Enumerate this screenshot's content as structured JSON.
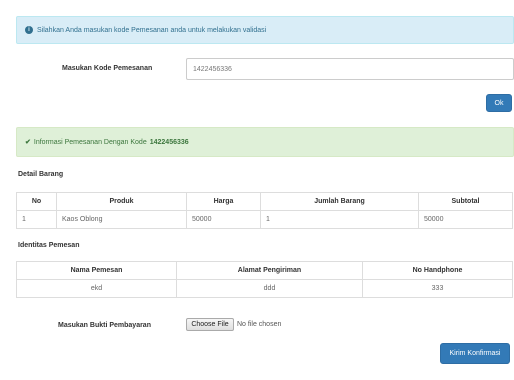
{
  "info_alert": {
    "text": "Silahkan Anda masukan kode Pemesanan anda untuk melakukan validasi"
  },
  "kode_form": {
    "label": "Masukan Kode Pemesanan",
    "value": "1422456336",
    "button": "Ok"
  },
  "success_alert": {
    "text": "Informasi Pemesanan Dengan Kode",
    "code": "1422456336"
  },
  "detail_barang": {
    "title": "Detail Barang",
    "headers": [
      "No",
      "Produk",
      "Harga",
      "Jumlah Barang",
      "Subtotal"
    ],
    "rows": [
      [
        "1",
        "Kaos Oblong",
        "50000",
        "1",
        "50000"
      ]
    ]
  },
  "identitas": {
    "title": "Identitas Pemesan",
    "headers": [
      "Nama Pemesan",
      "Alamat Pengiriman",
      "No Handphone"
    ],
    "rows": [
      [
        "ekd",
        "ddd",
        "333"
      ]
    ]
  },
  "bukti": {
    "label": "Masukan Bukti Pembayaran",
    "file_button": "Choose File",
    "file_status": "No file chosen"
  },
  "konfirmasi_button": "Kirim Konfirmasi",
  "colors": {
    "primary": "#337ab7",
    "info_bg": "#d9edf7",
    "success_bg": "#dff0d8"
  }
}
